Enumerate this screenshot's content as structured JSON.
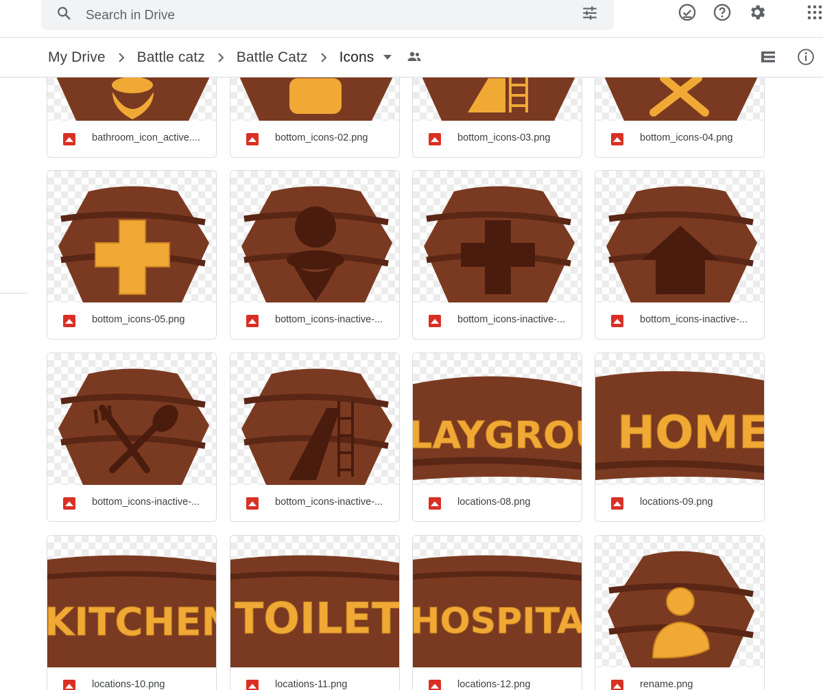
{
  "search": {
    "placeholder": "Search in Drive"
  },
  "icons": {
    "search": "search-icon",
    "tune": "tune-icon",
    "offline": "offline-status-icon",
    "help": "help-icon",
    "settings": "settings-gear-icon",
    "apps": "apps-grid-icon",
    "list_view": "list-view-icon",
    "info": "info-icon",
    "shared": "shared-people-icon"
  },
  "breadcrumbs": [
    {
      "label": "My Drive"
    },
    {
      "label": "Battle catz"
    },
    {
      "label": "Battle Catz"
    },
    {
      "label": "Icons"
    }
  ],
  "colors": {
    "wood": "#7a3a21",
    "wood_dark": "#5a2615",
    "accent": "#f0a935",
    "file_icon": "#d93025"
  },
  "files": [
    {
      "name": "bathroom_icon_active.png",
      "display": "bathroom_icon_active...."
    },
    {
      "name": "bottom_icons-02.png",
      "display": "bottom_icons-02.png"
    },
    {
      "name": "bottom_icons-03.png",
      "display": "bottom_icons-03.png"
    },
    {
      "name": "bottom_icons-04.png",
      "display": "bottom_icons-04.png"
    },
    {
      "name": "bottom_icons-05.png",
      "display": "bottom_icons-05.png"
    },
    {
      "name": "bottom_icons-inactive-",
      "display": "bottom_icons-inactive-..."
    },
    {
      "name": "bottom_icons-inactive-",
      "display": "bottom_icons-inactive-..."
    },
    {
      "name": "bottom_icons-inactive-",
      "display": "bottom_icons-inactive-..."
    },
    {
      "name": "bottom_icons-inactive-",
      "display": "bottom_icons-inactive-..."
    },
    {
      "name": "bottom_icons-inactive-",
      "display": "bottom_icons-inactive-..."
    },
    {
      "name": "locations-08.png",
      "display": "locations-08.png"
    },
    {
      "name": "locations-09.png",
      "display": "locations-09.png"
    },
    {
      "name": "locations-10.png",
      "display": "locations-10.png"
    },
    {
      "name": "locations-11.png",
      "display": "locations-11.png"
    },
    {
      "name": "locations-12.png",
      "display": "locations-12.png"
    },
    {
      "name": "rename.png",
      "display": "rename.png"
    }
  ],
  "sign_text": {
    "locations_08": "LAYGROUN",
    "locations_09": "HOME",
    "locations_10": "KITCHEN",
    "locations_11": "TOILET",
    "locations_12": "HOSPITAL"
  }
}
